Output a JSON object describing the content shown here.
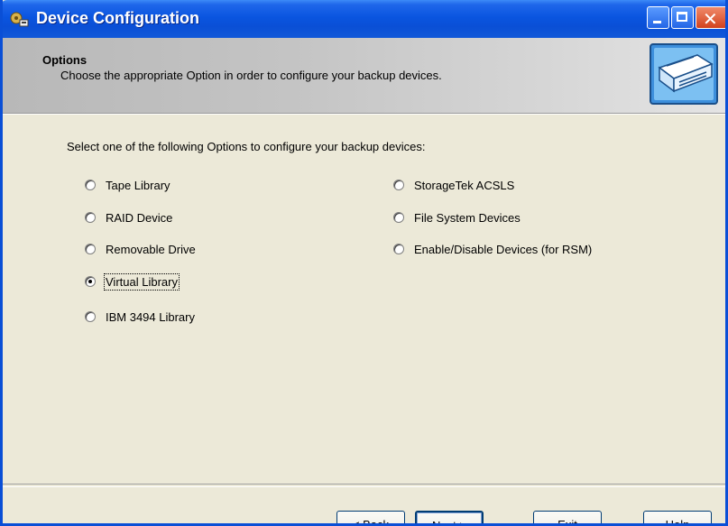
{
  "window": {
    "title": "Device Configuration"
  },
  "header": {
    "title": "Options",
    "subtitle": "Choose the appropriate Option in order to configure your backup devices."
  },
  "instruction": "Select one of the following Options to configure your backup devices:",
  "options_left": [
    {
      "label": "Tape Library",
      "selected": false
    },
    {
      "label": "RAID Device",
      "selected": false
    },
    {
      "label": "Removable Drive",
      "selected": false
    },
    {
      "label": "Virtual Library",
      "selected": true
    },
    {
      "label": "IBM 3494 Library",
      "selected": false
    }
  ],
  "options_right": [
    {
      "label": "StorageTek ACSLS",
      "selected": false
    },
    {
      "label": "File System Devices",
      "selected": false
    },
    {
      "label": "Enable/Disable Devices (for RSM)",
      "selected": false
    }
  ],
  "buttons": {
    "back": "< Back",
    "next": "Next >",
    "exit": "Exit",
    "help": "Help"
  },
  "colors": {
    "titlebar": "#0a4fd6",
    "dialog_bg": "#ece9d8",
    "close_button": "#d2421e"
  }
}
